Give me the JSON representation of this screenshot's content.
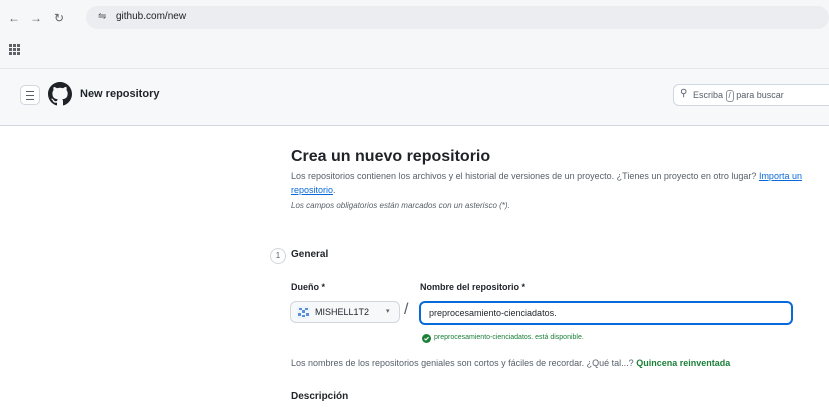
{
  "browser": {
    "back_icon": "←",
    "forward_icon": "→",
    "reload_icon": "↻",
    "site_settings_icon": "⇋",
    "url": "github.com/new"
  },
  "header": {
    "title": "New repository",
    "search_text_before": "Escriba",
    "search_key": "/",
    "search_text_after": "para buscar",
    "search_icon": "⚲"
  },
  "main": {
    "title": "Crea un nuevo repositorio",
    "intro_text": "Los repositorios contienen los archivos y el historial de versiones de un proyecto. ¿Tienes un proyecto en otro lugar?",
    "import_link": "Importa un repositorio",
    "intro_end": ".",
    "required_note": "Los campos obligatorios están marcados con un asterisco (*).",
    "step_number": "1",
    "section_title": "General",
    "owner_label": "Dueño *",
    "owner_value": "MISHELL1T2",
    "owner_caret": "▾",
    "slash": "/",
    "repo_label": "Nombre del repositorio *",
    "repo_value": "preprocesamiento-cienciadatos.",
    "availability": "preprocesamiento-cienciadatos. está disponible.",
    "tip_text": "Los nombres de los repositorios geniales son cortos y fáciles de recordar. ¿Qué tal...?",
    "tip_suggestion": "Quincena reinventada",
    "description_label": "Descripción"
  },
  "colors": {
    "accent_blue": "#0969da",
    "success_green": "#1a7f37",
    "muted_text": "#57606a",
    "header_bg": "#f6f8fa"
  }
}
